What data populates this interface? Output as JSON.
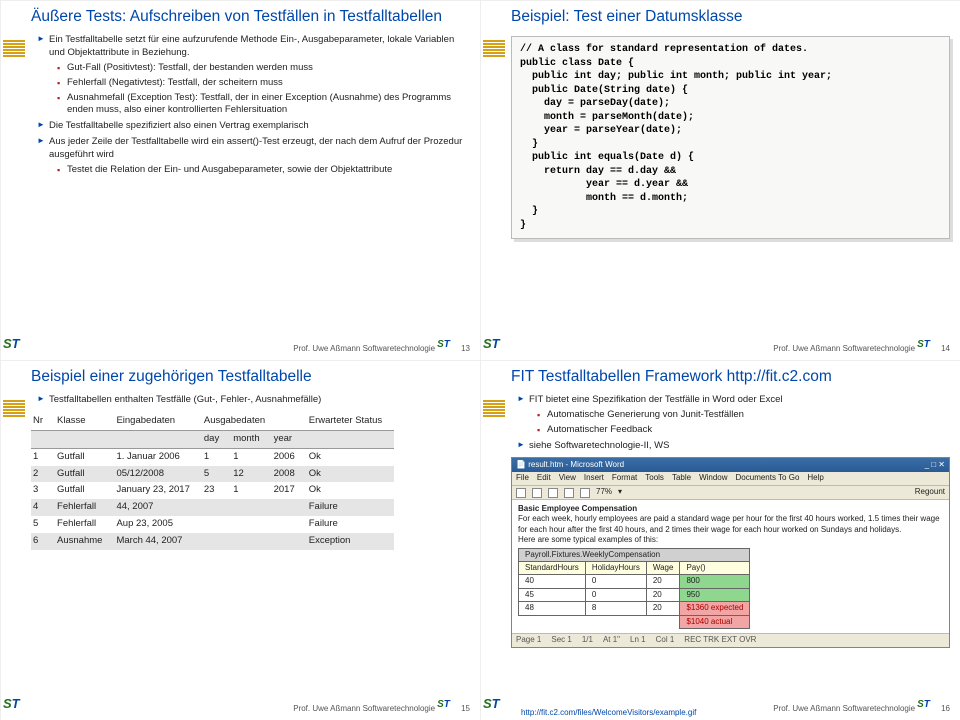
{
  "slide1": {
    "title": "Äußere Tests: Aufschreiben von Testfällen in Testfalltabellen",
    "p1": "Ein Testfalltabelle setzt für eine aufzurufende Methode Ein-, Ausgabeparameter, lokale Variablen und Objektattribute in Beziehung.",
    "p2": "Gut-Fall (Positivtest): Testfall, der bestanden werden muss",
    "p3": "Fehlerfall (Negativtest): Testfall, der scheitern muss",
    "p4": "Ausnahmefall (Exception Test): Testfall, der in einer Exception (Ausnahme) des Programms enden muss, also einer kontrollierten Fehlersituation",
    "p5": "Die Testfalltabelle spezifiziert also einen Vertrag exemplarisch",
    "p6": "Aus jeder Zeile der Testfalltabelle wird ein assert()-Test erzeugt, der nach dem Aufruf der Prozedur ausgeführt wird",
    "p7": "Testet die Relation der Ein- und Ausgabeparameter, sowie der Objektattribute",
    "num": "13"
  },
  "slide2": {
    "title": "Beispiel: Test einer Datumsklasse",
    "code": "// A class for standard representation of dates.\npublic class Date {\n  public int day; public int month; public int year;\n  public Date(String date) {\n    day = parseDay(date);\n    month = parseMonth(date);\n    year = parseYear(date);\n  }\n  public int equals(Date d) {\n    return day == d.day &&\n           year == d.year &&\n           month == d.month;\n  }\n}",
    "num": "14"
  },
  "slide3": {
    "title": "Beispiel einer zugehörigen Testfalltabelle",
    "p1": "Testfalltabellen enthalten Testfälle (Gut-, Fehler-, Ausnahmefälle)",
    "headers": {
      "nr": "Nr",
      "kl": "Klasse",
      "ein": "Eingabedaten",
      "aus": "Ausgabedaten",
      "erw": "Erwarteter Status",
      "day": "day",
      "month": "month",
      "year": "year"
    },
    "rows": [
      {
        "nr": "1",
        "kl": "Gutfall",
        "ein": "1. Januar 2006",
        "d": "1",
        "m": "1",
        "y": "2006",
        "s": "Ok"
      },
      {
        "nr": "2",
        "kl": "Gutfall",
        "ein": "05/12/2008",
        "d": "5",
        "m": "12",
        "y": "2008",
        "s": "Ok"
      },
      {
        "nr": "3",
        "kl": "Gutfall",
        "ein": "January 23, 2017",
        "d": "23",
        "m": "1",
        "y": "2017",
        "s": "Ok"
      },
      {
        "nr": "4",
        "kl": "Fehlerfall",
        "ein": "44, 2007",
        "d": "",
        "m": "",
        "y": "",
        "s": "Failure"
      },
      {
        "nr": "5",
        "kl": "Fehlerfall",
        "ein": "Aup 23, 2005",
        "d": "",
        "m": "",
        "y": "",
        "s": "Failure"
      },
      {
        "nr": "6",
        "kl": "Ausnahme",
        "ein": "March 44, 2007",
        "d": "",
        "m": "",
        "y": "",
        "s": "Exception"
      }
    ],
    "num": "15"
  },
  "slide4": {
    "title": "FIT Testfalltabellen Framework http://fit.c2.com",
    "p1": "FIT bietet eine Spezifikation der Testfälle in Word oder Excel",
    "p2": "Automatische Generierung von Junit-Testfällen",
    "p3": "Automatischer Feedback",
    "p4": "siehe Softwaretechnologie-II, WS",
    "word": {
      "title": "result.htm - Microsoft Word",
      "menus": [
        "File",
        "Edit",
        "View",
        "Insert",
        "Format",
        "Tools",
        "Table",
        "Window",
        "Documents To Go",
        "Help"
      ],
      "zoom": "77%",
      "regount": "Regount",
      "heading": "Basic Employee Compensation",
      "body1": "For each week, hourly employees are paid a standard wage per hour for the first 40 hours worked, 1.5 times their wage for each hour after the first 40 hours, and 2 times their wage for each hour worked on Sundays and holidays.",
      "body2": "Here are some typical examples of this:",
      "thead": [
        "Payroll.Fixtures.WeeklyCompensation",
        "",
        "",
        ""
      ],
      "trow1": [
        "StandardHours",
        "HolidayHours",
        "Wage",
        "Pay()"
      ],
      "trows": [
        [
          "40",
          "0",
          "20",
          "800"
        ],
        [
          "45",
          "0",
          "20",
          "950"
        ],
        [
          "48",
          "8",
          "20",
          "$1360 expected",
          true
        ],
        [
          "",
          "",
          "",
          "$1040 actual"
        ]
      ],
      "status": [
        "Page 1",
        "Sec 1",
        "1/1",
        "At 1\"",
        "Ln 1",
        "Col 1",
        "REC TRK EXT OVR"
      ]
    },
    "link": "http://fit.c2.com/files/WelcomeVisitors/example.gif",
    "num": "16"
  },
  "common": {
    "footer": "Prof. Uwe Aßmann  Softwaretechnologie"
  }
}
